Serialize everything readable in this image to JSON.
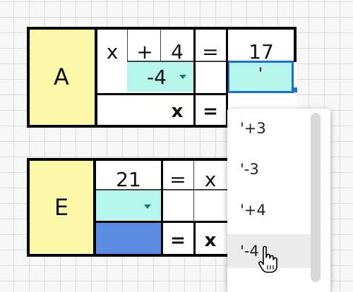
{
  "colors": {
    "label_bg": "#fbf9a8",
    "aqua": "#b5f5ec",
    "selected_border": "#1a6fd6",
    "answer_fill": "#5b8be0"
  },
  "table_a": {
    "label": "A",
    "row1": [
      "x",
      "+",
      "4",
      "=",
      "17"
    ],
    "operation_value": "-4",
    "active_input_value": "'",
    "row3": [
      "x",
      "="
    ]
  },
  "table_e": {
    "label": "E",
    "row1": [
      "21",
      "=",
      "x"
    ],
    "operation_value": "",
    "row3": [
      "=",
      "x"
    ]
  },
  "dropdown": {
    "options": [
      "'+3",
      "'-3",
      "'+4",
      "'-4"
    ],
    "hovered_index": 3
  },
  "icons": {
    "caret": "chevron-down-icon",
    "cursor": "hand-pointer-icon"
  }
}
